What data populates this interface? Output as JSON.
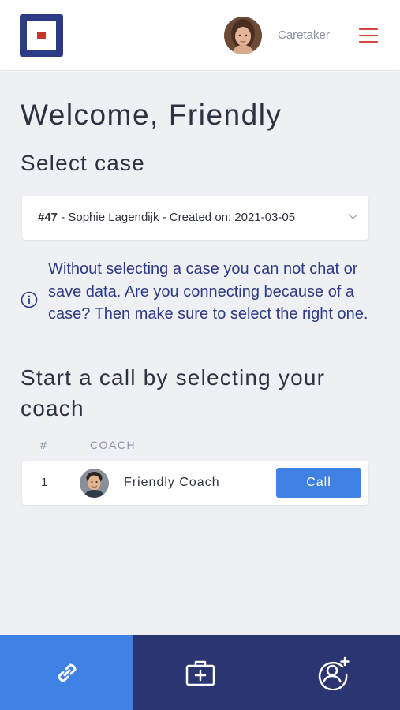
{
  "header": {
    "role": "Caretaker"
  },
  "main": {
    "welcome": "Welcome,",
    "user_name": "Friendly",
    "select_case_title": "Select case",
    "case_select": {
      "case_number": "#47",
      "case_details": " - Sophie Lagendijk - Created on: 2021-03-05"
    },
    "info_text": "Without selecting a case you can not chat or save data. Are you connecting because of a case? Then make sure to select the right one.",
    "call_title": "Start a call by selecting your coach",
    "table": {
      "columns": [
        "#",
        "COACH"
      ],
      "rows": [
        {
          "index": "1",
          "coach": "Friendly Coach",
          "action": "Call"
        }
      ]
    }
  },
  "bottom_nav": {
    "items": [
      {
        "icon": "link-icon",
        "active": true
      },
      {
        "icon": "medical-case-icon",
        "active": false
      },
      {
        "icon": "add-coach-icon",
        "active": false
      }
    ]
  },
  "colors": {
    "brand_navy": "#2b3572",
    "accent_blue": "#3f82e4",
    "menu_red": "#d5463f",
    "background": "#eef0f4"
  }
}
